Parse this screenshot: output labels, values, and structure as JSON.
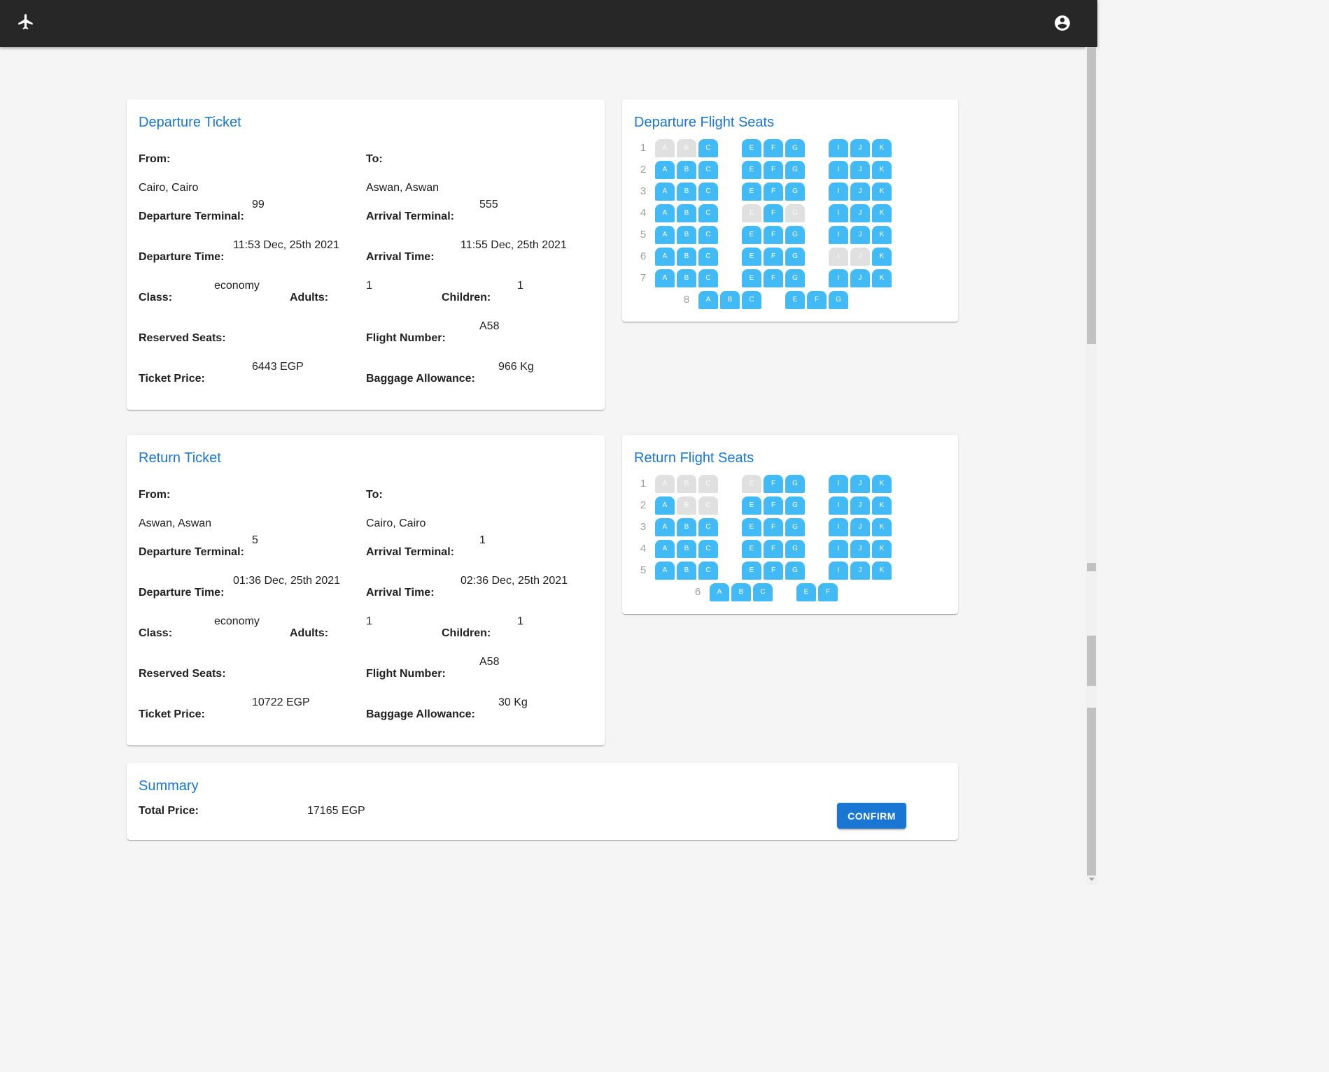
{
  "app": {
    "plane_icon": "airplane-icon",
    "account_icon": "account-circle-icon"
  },
  "departure_ticket": {
    "title": "Departure Ticket",
    "from_label": "From:",
    "from": "Cairo, Cairo",
    "to_label": "To:",
    "to": "Aswan, Aswan",
    "dep_terminal_label": "Departure Terminal:",
    "dep_terminal": "99",
    "arr_terminal_label": "Arrival Terminal:",
    "arr_terminal": "555",
    "dep_time_label": "Departure Time:",
    "dep_time": "11:53 Dec, 25th 2021",
    "arr_time_label": "Arrival Time:",
    "arr_time": "11:55 Dec, 25th 2021",
    "class_label": "Class:",
    "class": "economy",
    "adults_label": "Adults:",
    "adults": "1",
    "children_label": "Children:",
    "children": "1",
    "reserved_label": "Reserved Seats:",
    "reserved": "",
    "flight_label": "Flight Number:",
    "flight": "A58",
    "price_label": "Ticket Price:",
    "price": "6443 EGP",
    "baggage_label": "Baggage Allowance:",
    "baggage": "966 Kg"
  },
  "return_ticket": {
    "title": "Return Ticket",
    "from_label": "From:",
    "from": "Aswan, Aswan",
    "to_label": "To:",
    "to": "Cairo, Cairo",
    "dep_terminal_label": "Departure Terminal:",
    "dep_terminal": "5",
    "arr_terminal_label": "Arrival Terminal:",
    "arr_terminal": "1",
    "dep_time_label": "Departure Time:",
    "dep_time": "01:36 Dec, 25th 2021",
    "arr_time_label": "Arrival Time:",
    "arr_time": "02:36 Dec, 25th 2021",
    "class_label": "Class:",
    "class": "economy",
    "adults_label": "Adults:",
    "adults": "1",
    "children_label": "Children:",
    "children": "1",
    "reserved_label": "Reserved Seats:",
    "reserved": "",
    "flight_label": "Flight Number:",
    "flight": "A58",
    "price_label": "Ticket Price:",
    "price": "10722 EGP",
    "baggage_label": "Baggage Allowance:",
    "baggage": "30 Kg"
  },
  "departure_seats": {
    "title": "Departure Flight Seats",
    "rows": [
      {
        "num": "1",
        "seats": [
          {
            "l": "A",
            "t": true
          },
          {
            "l": "B",
            "t": true
          },
          {
            "l": "C",
            "t": false
          },
          {
            "l": "E",
            "t": false
          },
          {
            "l": "F",
            "t": false
          },
          {
            "l": "G",
            "t": false
          },
          {
            "l": "I",
            "t": false
          },
          {
            "l": "J",
            "t": false
          },
          {
            "l": "K",
            "t": false
          }
        ]
      },
      {
        "num": "2",
        "seats": [
          {
            "l": "A",
            "t": false
          },
          {
            "l": "B",
            "t": false
          },
          {
            "l": "C",
            "t": false
          },
          {
            "l": "E",
            "t": false
          },
          {
            "l": "F",
            "t": false
          },
          {
            "l": "G",
            "t": false
          },
          {
            "l": "I",
            "t": false
          },
          {
            "l": "J",
            "t": false
          },
          {
            "l": "K",
            "t": false
          }
        ]
      },
      {
        "num": "3",
        "seats": [
          {
            "l": "A",
            "t": false
          },
          {
            "l": "B",
            "t": false
          },
          {
            "l": "C",
            "t": false
          },
          {
            "l": "E",
            "t": false
          },
          {
            "l": "F",
            "t": false
          },
          {
            "l": "G",
            "t": false
          },
          {
            "l": "I",
            "t": false
          },
          {
            "l": "J",
            "t": false
          },
          {
            "l": "K",
            "t": false
          }
        ]
      },
      {
        "num": "4",
        "seats": [
          {
            "l": "A",
            "t": false
          },
          {
            "l": "B",
            "t": false
          },
          {
            "l": "C",
            "t": false
          },
          {
            "l": "E",
            "t": true
          },
          {
            "l": "F",
            "t": false
          },
          {
            "l": "G",
            "t": true
          },
          {
            "l": "I",
            "t": false
          },
          {
            "l": "J",
            "t": false
          },
          {
            "l": "K",
            "t": false
          }
        ]
      },
      {
        "num": "5",
        "seats": [
          {
            "l": "A",
            "t": false
          },
          {
            "l": "B",
            "t": false
          },
          {
            "l": "C",
            "t": false
          },
          {
            "l": "E",
            "t": false
          },
          {
            "l": "F",
            "t": false
          },
          {
            "l": "G",
            "t": false
          },
          {
            "l": "I",
            "t": false
          },
          {
            "l": "J",
            "t": false
          },
          {
            "l": "K",
            "t": false
          }
        ]
      },
      {
        "num": "6",
        "seats": [
          {
            "l": "A",
            "t": false
          },
          {
            "l": "B",
            "t": false
          },
          {
            "l": "C",
            "t": false
          },
          {
            "l": "E",
            "t": false
          },
          {
            "l": "F",
            "t": false
          },
          {
            "l": "G",
            "t": false
          },
          {
            "l": "I",
            "t": true
          },
          {
            "l": "J",
            "t": true
          },
          {
            "l": "K",
            "t": false
          }
        ]
      },
      {
        "num": "7",
        "seats": [
          {
            "l": "A",
            "t": false
          },
          {
            "l": "B",
            "t": false
          },
          {
            "l": "C",
            "t": false
          },
          {
            "l": "E",
            "t": false
          },
          {
            "l": "F",
            "t": false
          },
          {
            "l": "G",
            "t": false
          },
          {
            "l": "I",
            "t": false
          },
          {
            "l": "J",
            "t": false
          },
          {
            "l": "K",
            "t": false
          }
        ]
      }
    ],
    "last_row": {
      "num": "8",
      "seats": [
        {
          "l": "A",
          "t": false
        },
        {
          "l": "B",
          "t": false
        },
        {
          "l": "C",
          "t": false
        },
        {
          "l": "E",
          "t": false
        },
        {
          "l": "F",
          "t": false
        },
        {
          "l": "G",
          "t": false
        }
      ]
    }
  },
  "return_seats": {
    "title": "Return Flight Seats",
    "rows": [
      {
        "num": "1",
        "seats": [
          {
            "l": "A",
            "t": true
          },
          {
            "l": "B",
            "t": true
          },
          {
            "l": "C",
            "t": true
          },
          {
            "l": "E",
            "t": true
          },
          {
            "l": "F",
            "t": false
          },
          {
            "l": "G",
            "t": false
          },
          {
            "l": "I",
            "t": false
          },
          {
            "l": "J",
            "t": false
          },
          {
            "l": "K",
            "t": false
          }
        ]
      },
      {
        "num": "2",
        "seats": [
          {
            "l": "A",
            "t": false
          },
          {
            "l": "B",
            "t": true
          },
          {
            "l": "C",
            "t": true
          },
          {
            "l": "E",
            "t": false
          },
          {
            "l": "F",
            "t": false
          },
          {
            "l": "G",
            "t": false
          },
          {
            "l": "I",
            "t": false
          },
          {
            "l": "J",
            "t": false
          },
          {
            "l": "K",
            "t": false
          }
        ]
      },
      {
        "num": "3",
        "seats": [
          {
            "l": "A",
            "t": false
          },
          {
            "l": "B",
            "t": false
          },
          {
            "l": "C",
            "t": false
          },
          {
            "l": "E",
            "t": false
          },
          {
            "l": "F",
            "t": false
          },
          {
            "l": "G",
            "t": false
          },
          {
            "l": "I",
            "t": false
          },
          {
            "l": "J",
            "t": false
          },
          {
            "l": "K",
            "t": false
          }
        ]
      },
      {
        "num": "4",
        "seats": [
          {
            "l": "A",
            "t": false
          },
          {
            "l": "B",
            "t": false
          },
          {
            "l": "C",
            "t": false
          },
          {
            "l": "E",
            "t": false
          },
          {
            "l": "F",
            "t": false
          },
          {
            "l": "G",
            "t": false
          },
          {
            "l": "I",
            "t": false
          },
          {
            "l": "J",
            "t": false
          },
          {
            "l": "K",
            "t": false
          }
        ]
      },
      {
        "num": "5",
        "seats": [
          {
            "l": "A",
            "t": false
          },
          {
            "l": "B",
            "t": false
          },
          {
            "l": "C",
            "t": false
          },
          {
            "l": "E",
            "t": false
          },
          {
            "l": "F",
            "t": false
          },
          {
            "l": "G",
            "t": false
          },
          {
            "l": "I",
            "t": false
          },
          {
            "l": "J",
            "t": false
          },
          {
            "l": "K",
            "t": false
          }
        ]
      }
    ],
    "last_row": {
      "num": "6",
      "seats": [
        {
          "l": "A",
          "t": false
        },
        {
          "l": "B",
          "t": false
        },
        {
          "l": "C",
          "t": false
        },
        {
          "l": "E",
          "t": false
        },
        {
          "l": "F",
          "t": false
        }
      ]
    }
  },
  "summary": {
    "title": "Summary",
    "total_label": "Total Price:",
    "total": "17165 EGP",
    "confirm_label": "CONFIRM"
  },
  "colors": {
    "accent": "#1976d2",
    "seat_available": "#42baf5",
    "seat_taken": "#e0e0e0",
    "appbar": "#272727"
  }
}
